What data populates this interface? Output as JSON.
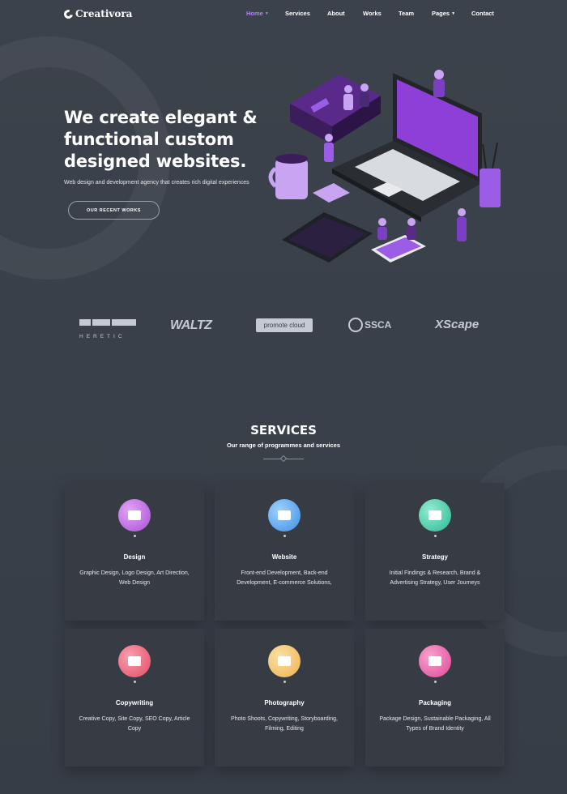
{
  "brand": {
    "name": "Creativora"
  },
  "nav": {
    "items": [
      {
        "label": "Home",
        "active": true,
        "dropdown": true
      },
      {
        "label": "Services",
        "active": false,
        "dropdown": false
      },
      {
        "label": "About",
        "active": false,
        "dropdown": false
      },
      {
        "label": "Works",
        "active": false,
        "dropdown": false
      },
      {
        "label": "Team",
        "active": false,
        "dropdown": false
      },
      {
        "label": "Pages",
        "active": false,
        "dropdown": true
      },
      {
        "label": "Contact",
        "active": false,
        "dropdown": false
      }
    ]
  },
  "hero": {
    "title_line1": "We create elegant &",
    "title_line2": "functional custom",
    "title_line3_a": "designed",
    "title_line3_b": "websites.",
    "subtitle": "Web design and development agency that creates rich digital experiences",
    "cta_label": "OUR RECENT WORKS"
  },
  "partners": {
    "heretic": "HERETIC",
    "waltz": "WALTZ",
    "promote": "promote cloud",
    "ssca": "SSCA",
    "xscape": "XScape"
  },
  "services": {
    "title": "SERVICES",
    "subtitle": "Our range of programmes and services",
    "cards": [
      {
        "title": "Design",
        "desc": "Graphic Design, Logo Design, Art Direction, Web Design",
        "icon": "design-icon",
        "color": "#c36ee6"
      },
      {
        "title": "Website",
        "desc": "Front-end Development, Back-end Development, E-commerce Solutions,",
        "icon": "code-icon",
        "color": "#4fa8f0"
      },
      {
        "title": "Strategy",
        "desc": "Initial Findings & Research, Brand & Advertising Strategy, User Journeys",
        "icon": "strategy-icon",
        "color": "#3fcfa8"
      },
      {
        "title": "Copywriting",
        "desc": "Creative Copy, Site Copy, SEO Copy, Article Copy",
        "icon": "copywriting-icon",
        "color": "#f0637d"
      },
      {
        "title": "Photography",
        "desc": "Photo Shoots, Copywriting, Storyboarding, Filming, Editing",
        "icon": "photography-icon",
        "color": "#f5c16b"
      },
      {
        "title": "Packaging",
        "desc": "Package Design, Sustainable Packaging, All Types of Brand Identity",
        "icon": "packaging-icon",
        "color": "#ee5fa8"
      }
    ]
  },
  "colors": {
    "accent": "#9b5de5",
    "background": "#3a4049",
    "card": "#373c44"
  }
}
